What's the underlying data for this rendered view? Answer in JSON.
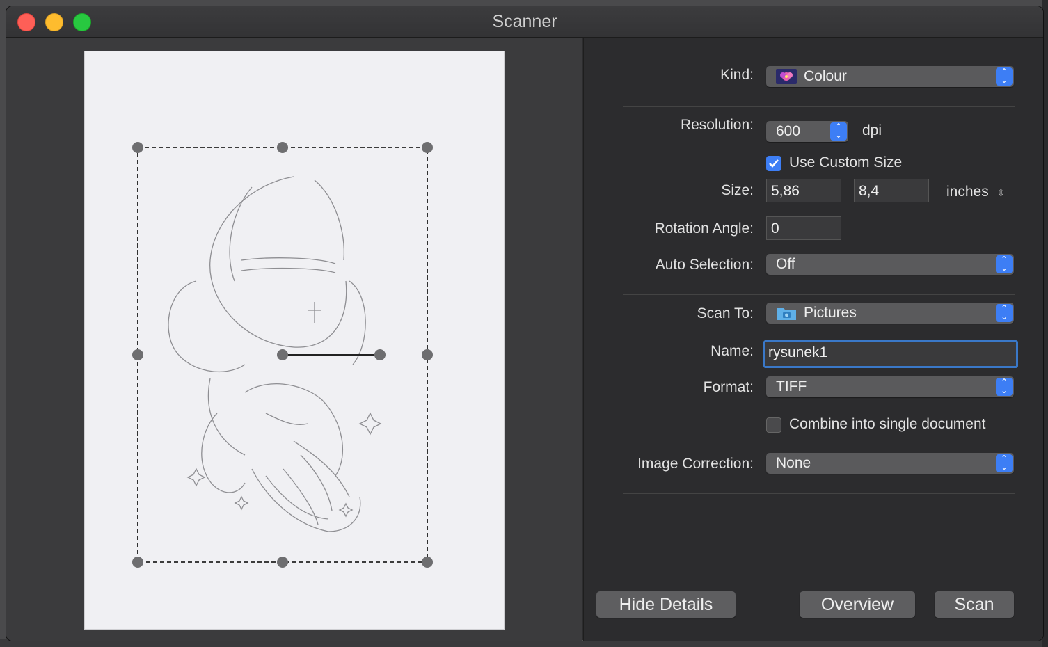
{
  "window": {
    "title": "Scanner"
  },
  "controls": {
    "kind": {
      "label": "Kind:",
      "value": "Colour",
      "icon": "colour-flower-icon"
    },
    "resolution": {
      "label": "Resolution:",
      "value": "600",
      "unit": "dpi"
    },
    "custom_size": {
      "label": "Use Custom Size",
      "checked": true
    },
    "size": {
      "label": "Size:",
      "width": "5,86",
      "height": "8,4",
      "unit": "inches"
    },
    "rotation": {
      "label": "Rotation Angle:",
      "value": "0"
    },
    "auto_selection": {
      "label": "Auto Selection:",
      "value": "Off"
    },
    "scan_to": {
      "label": "Scan To:",
      "value": "Pictures",
      "icon": "folder-camera-icon"
    },
    "name": {
      "label": "Name:",
      "value": "rysunek1"
    },
    "format": {
      "label": "Format:",
      "value": "TIFF"
    },
    "combine": {
      "label": "Combine into single document",
      "checked": false
    },
    "image_correction": {
      "label": "Image Correction:",
      "value": "None"
    }
  },
  "buttons": {
    "hide_details": "Hide Details",
    "overview": "Overview",
    "scan": "Scan"
  },
  "colors": {
    "accent": "#3d7ef5",
    "close": "#fe5f57",
    "minimize": "#febc2e",
    "maximize": "#28c840"
  }
}
